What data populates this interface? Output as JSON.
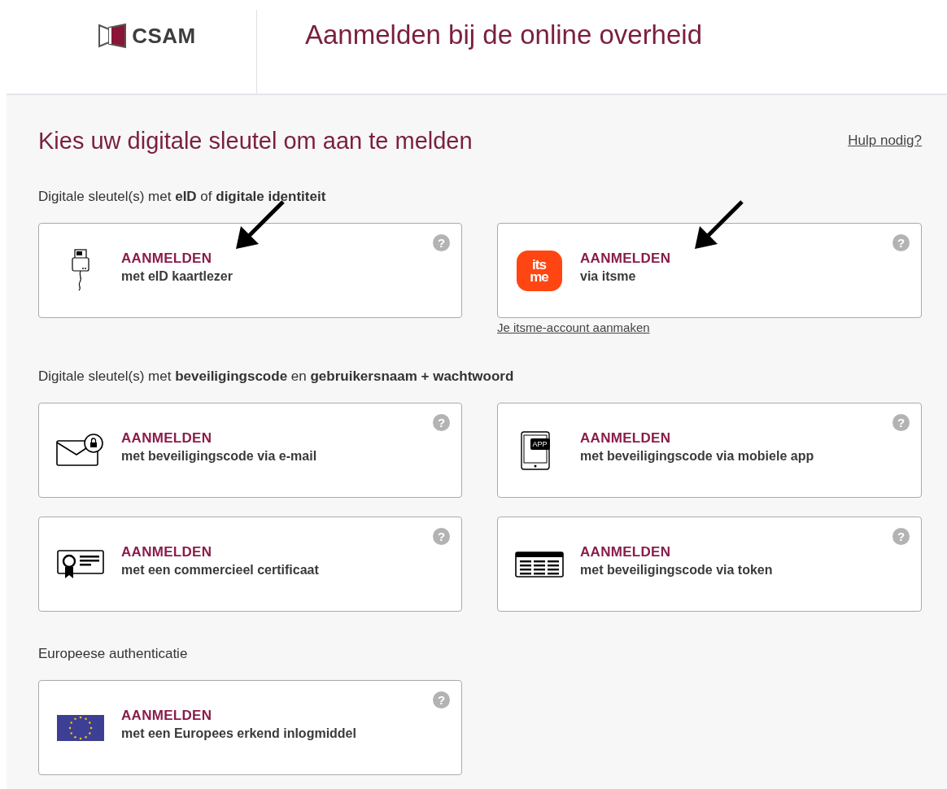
{
  "header": {
    "logo_text": "CSAM",
    "title": "Aanmelden bij de online overheid"
  },
  "heading": "Kies uw digitale sleutel om aan te melden",
  "help_link": "Hulp nodig?",
  "sections": [
    {
      "label": "Digitale sleutel(s) met **eID** of **digitale identiteit**",
      "cards": [
        {
          "kind": "card-reader",
          "action": "AANMELDEN",
          "description": "met eID kaartlezer",
          "help": "?",
          "arrow": true
        },
        {
          "kind": "itsme",
          "icon_text": [
            "its",
            "me"
          ],
          "action": "AANMELDEN",
          "description": "via itsme",
          "help": "?",
          "arrow": true,
          "link": "Je itsme-account aanmaken"
        }
      ]
    },
    {
      "label": "Digitale sleutel(s) met **beveiligingscode** en **gebruikersnaam + wachtwoord**",
      "cards": [
        {
          "kind": "mail",
          "action": "AANMELDEN",
          "description": "met beveiligingscode via e-mail",
          "help": "?",
          "arrow": false
        },
        {
          "kind": "app",
          "icon_text": [
            "APP"
          ],
          "action": "AANMELDEN",
          "description": "met beveiligingscode via mobiele app",
          "help": "?",
          "arrow": false
        },
        {
          "kind": "certificate",
          "action": "AANMELDEN",
          "description": "met een commercieel certificaat",
          "help": "?",
          "arrow": false
        },
        {
          "kind": "token",
          "action": "AANMELDEN",
          "description": "met beveiligingscode via token",
          "help": "?",
          "arrow": false
        }
      ]
    },
    {
      "label": "Europeese authenticatie",
      "cards": [
        {
          "kind": "eu-flag",
          "action": "AANMELDEN",
          "description": "met een Europees erkend inlogmiddel",
          "help": "?",
          "arrow": false
        }
      ]
    }
  ]
}
